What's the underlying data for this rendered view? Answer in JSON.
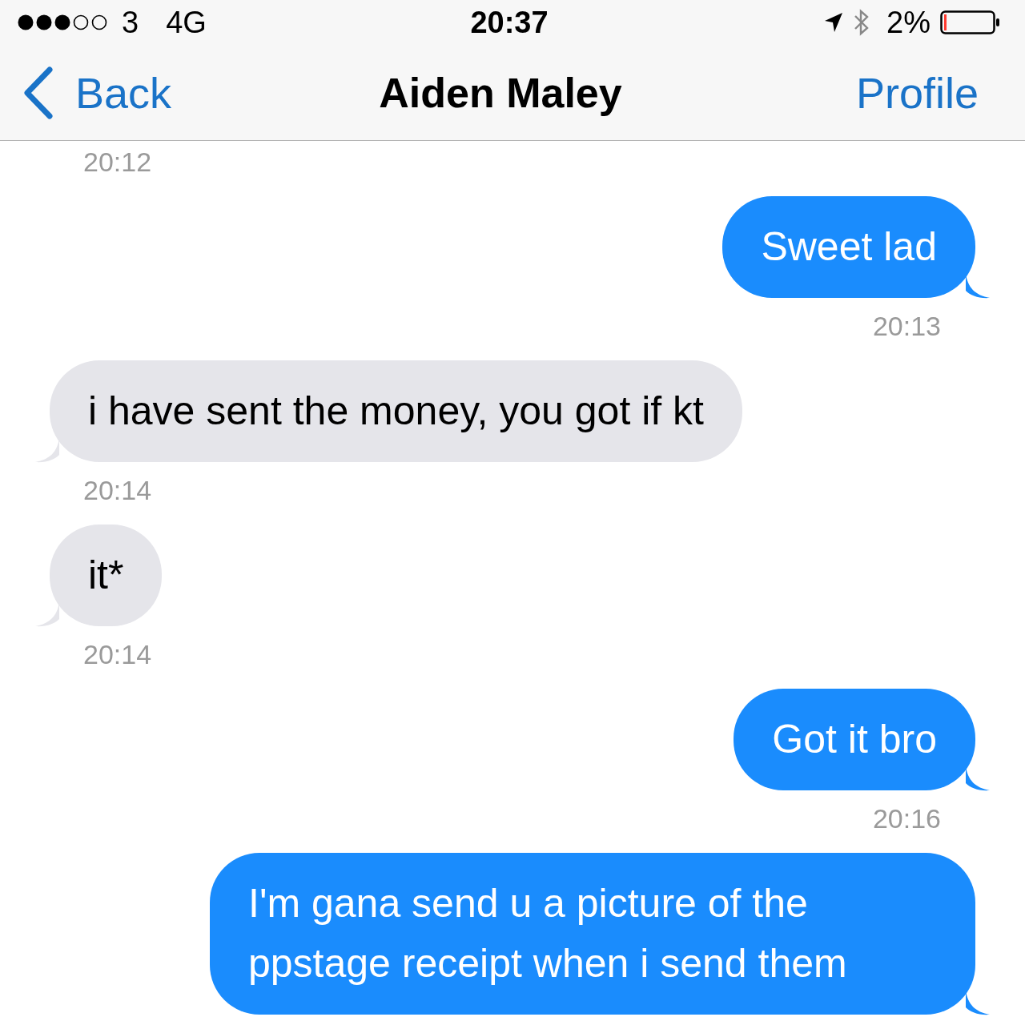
{
  "status_bar": {
    "carrier": "3",
    "network": "4G",
    "time": "20:37",
    "battery": "2%"
  },
  "nav": {
    "back": "Back",
    "title": "Aiden Maley",
    "action": "Profile"
  },
  "messages": [
    {
      "kind": "time_left",
      "text": "20:12"
    },
    {
      "kind": "sent",
      "text": "Sweet lad"
    },
    {
      "kind": "time_right",
      "text": "20:13"
    },
    {
      "kind": "received",
      "text": "i have sent the money, you got if kt"
    },
    {
      "kind": "time_left",
      "text": "20:14"
    },
    {
      "kind": "received",
      "text": "it*"
    },
    {
      "kind": "time_left",
      "text": "20:14"
    },
    {
      "kind": "sent",
      "text": "Got it bro"
    },
    {
      "kind": "time_right",
      "text": "20:16"
    },
    {
      "kind": "sent",
      "text": "I'm gana send u a picture of the ppstage receipt when i send them"
    }
  ]
}
